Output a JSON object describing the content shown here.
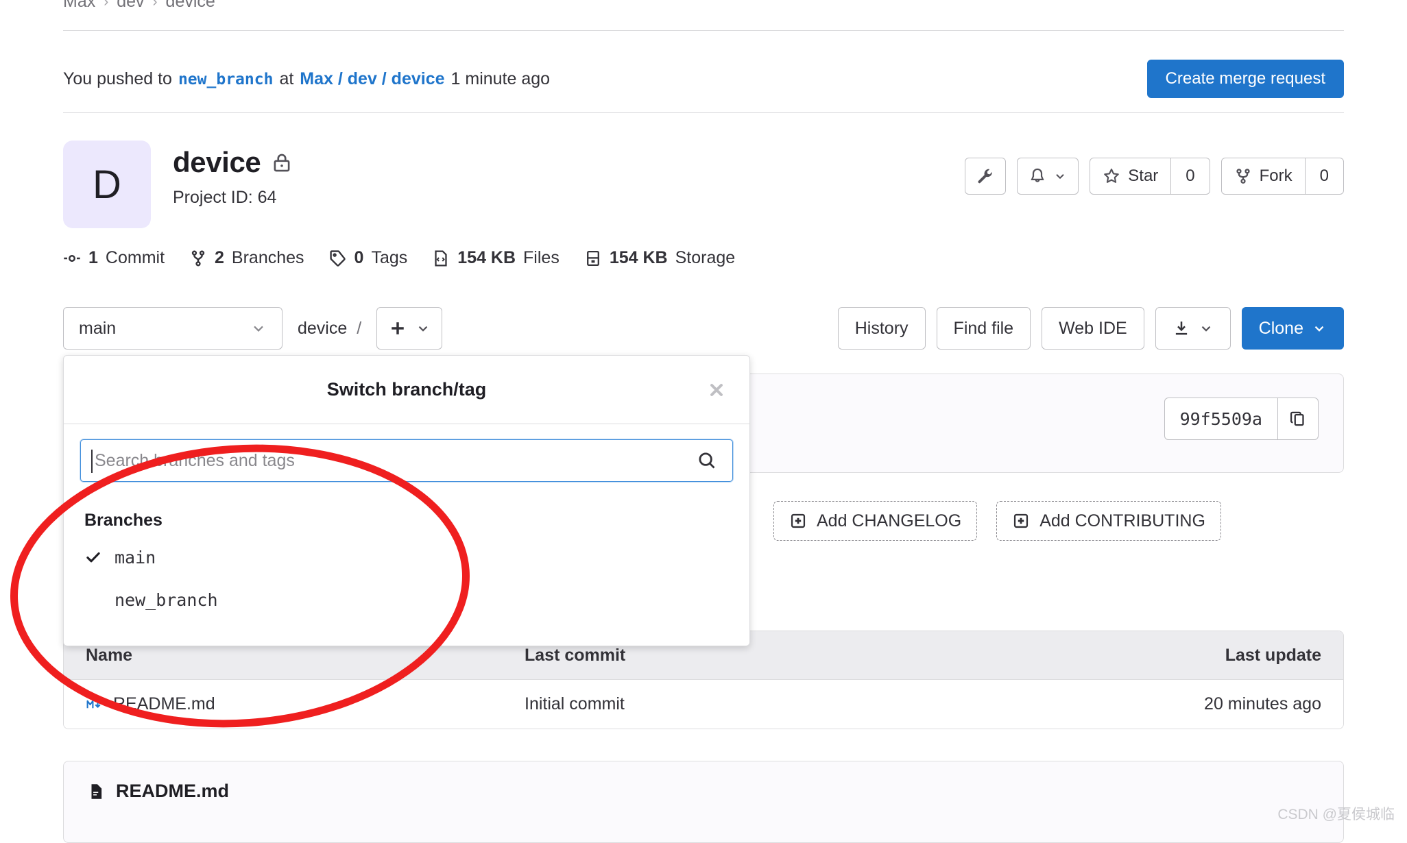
{
  "breadcrumb": {
    "items": [
      "Max",
      "dev",
      "device"
    ],
    "separator": "›"
  },
  "push_event": {
    "prefix": "You pushed to",
    "branch": "new_branch",
    "at": "at",
    "project_path": "Max / dev / device",
    "time": "1 minute ago",
    "merge_request_button": "Create merge request"
  },
  "project": {
    "avatar_letter": "D",
    "name": "device",
    "visibility_icon": "lock-icon",
    "project_id_label": "Project ID: 64"
  },
  "project_actions": {
    "settings_icon": "wrench-icon",
    "notifications_icon": "bell-icon",
    "star_label": "Star",
    "star_count": "0",
    "fork_label": "Fork",
    "fork_count": "0"
  },
  "stats": [
    {
      "icon": "commit-icon",
      "value": "1",
      "label": "Commit"
    },
    {
      "icon": "branch-icon",
      "value": "2",
      "label": "Branches"
    },
    {
      "icon": "tag-icon",
      "value": "0",
      "label": "Tags"
    },
    {
      "icon": "file-code-icon",
      "value": "154 KB",
      "label": "Files"
    },
    {
      "icon": "storage-icon",
      "value": "154 KB",
      "label": "Storage"
    }
  ],
  "toolbar": {
    "branch_selected": "main",
    "path_root": "device",
    "path_separator": "/",
    "add_button_icon": "plus-icon",
    "history_label": "History",
    "find_file_label": "Find file",
    "web_ide_label": "Web IDE",
    "download_icon": "download-icon",
    "clone_label": "Clone"
  },
  "commit_panel": {
    "sha": "99f5509a",
    "copy_icon": "clipboard-icon"
  },
  "add_files": [
    {
      "icon": "plus-square-icon",
      "label": "Add CHANGELOG"
    },
    {
      "icon": "plus-square-icon",
      "label": "Add CONTRIBUTING"
    }
  ],
  "file_table": {
    "columns": [
      "Name",
      "Last commit",
      "Last update"
    ],
    "rows": [
      {
        "icon": "markdown-icon",
        "name": "README.md",
        "last_commit": "Initial commit",
        "last_update": "20 minutes ago"
      }
    ]
  },
  "readme_card": {
    "icon": "document-icon",
    "title": "README.md"
  },
  "branch_dropdown": {
    "title": "Switch branch/tag",
    "close_icon": "close-icon",
    "search_placeholder": "Search branches and tags",
    "search_value": "",
    "search_icon": "search-icon",
    "group_label": "Branches",
    "items": [
      {
        "name": "main",
        "selected": true
      },
      {
        "name": "new_branch",
        "selected": false
      }
    ]
  },
  "annotation": {
    "color": "#ef1f1f",
    "shape": "ellipse"
  },
  "watermark": {
    "text": "CSDN @夏侯城临"
  }
}
